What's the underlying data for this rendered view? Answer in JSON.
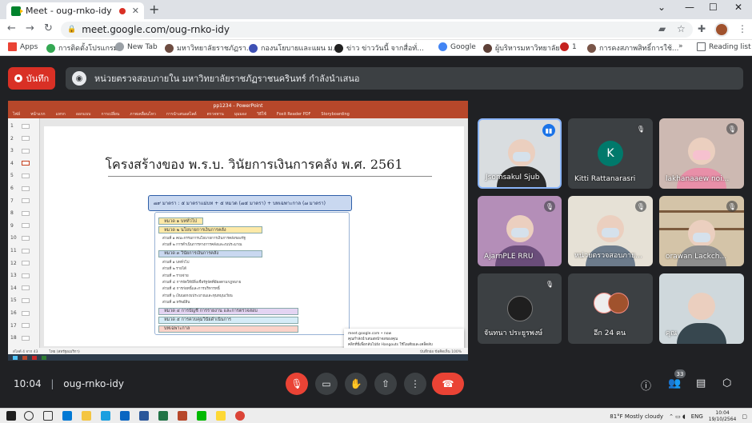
{
  "browser": {
    "tab_title": "Meet - oug-rnko-idy",
    "url": "meet.google.com/oug-rnko-idy",
    "bookmarks": [
      "Apps",
      "การติดตั้งโปรแกรม",
      "New Tab",
      "มหาวิทยาลัยราชภัฏรา...",
      "กองนโยบายและแผน ม...",
      "ข่าว ข่าววันนี้ จากสื่อทั่...",
      "Google",
      "ผู้บริหารมหาวิทยาลัย",
      "1",
      "การคงสภาพสิทธิ์การใช้...",
      "Reading list"
    ]
  },
  "meet": {
    "record_label": "บันทึก",
    "notice": "หน่วยตรวจสอบภายใน มหาวิทยาลัยราชภัฏราชนครินทร์ กำลังนำเสนอ",
    "meeting_code": "oug-rnko-idy",
    "time": "10:04",
    "participant_count": "33"
  },
  "presentation": {
    "window_title": "pp1234 - PowerPoint",
    "ribbon_tabs": [
      "ไฟล์",
      "หน้าแรก",
      "แทรก",
      "ออกแบบ",
      "การเปลี่ยน",
      "ภาพเคลื่อนไหว",
      "การนำเสนอสไลด์",
      "ตรวจทาน",
      "มุมมอง",
      "วิธีใช้",
      "Foxit Reader PDF",
      "Storyboarding"
    ],
    "slide_numbers": [
      "1",
      "2",
      "3",
      "4",
      "5",
      "6",
      "7",
      "8",
      "9",
      "10",
      "11",
      "12",
      "13",
      "14",
      "15",
      "16",
      "17",
      "18"
    ],
    "title": "โครงสร้างของ พ.ร.บ. วินัยการเงินการคลัง พ.ศ. 2561",
    "structure": "๗๙ มาตรา : ๕ มาตราแม่บท + ๕ หมวด (๗๕ มาตรา) + บทเฉพาะกาล (๗ มาตรา)",
    "chapters": [
      {
        "label": "หมวด ๑ บททั่วไป",
        "sections": []
      },
      {
        "label": "หมวด ๒ นโยบายการเงินการคลัง",
        "sections": [
          "ส่วนที่ ๑ คณะกรรมการนโยบายการเงินการคลังของรัฐ",
          "ส่วนที่ ๒ การดำเนินการทางการคลังและงบประมาณ"
        ]
      },
      {
        "label": "หมวด ๓ วินัยการเงินการคลัง",
        "sections": [
          "ส่วนที่ ๑ บททั่วไป",
          "ส่วนที่ ๒ รายได้",
          "ส่วนที่ ๓ รายจ่าย",
          "ส่วนที่ ๔ การจัดให้มีสิ่งเชื่อรัฐจัดที่มีผลตามกฎหมาย",
          "ส่วนที่ ๕ การก่อหนี้และการบริหารหนี้",
          "ส่วนที่ ๖ เงินนอกงบประมาณและทุนหมุนเวียน",
          "ส่วนที่ ๗ ทรัพย์สิน"
        ]
      },
      {
        "label": "หมวด ๔ การบัญชี การรายงาน และการตรวจสอบ",
        "sections": []
      },
      {
        "label": "หมวด ๕ การควบคุมวินัยดำเนินการ",
        "sections": []
      },
      {
        "label": "บทเฉพาะกาล",
        "sections": []
      }
    ],
    "popup": {
      "source": "meet.google.com • now",
      "line1": "คุณกำลังนำเสนอหน้าจอของคุณ",
      "line2": "คลิกที่นี่เพื่อกลับไปยัง Hangouts ใช้ไอเดียและเคล็ดลับ"
    },
    "status_left": "สไลด์ 4 จาก 43",
    "status_mid": "ไทย (สหรัฐอเมริกา)",
    "status_right": "บันทึกย่อ   ข้อคิดเห็น   100%"
  },
  "participants": [
    {
      "name": "Jsomsakul Sjub",
      "speaking": true
    },
    {
      "name": "Kitti Rattanarasri",
      "initial": "K"
    },
    {
      "name": "lakhanaaew noi..."
    },
    {
      "name": "AjarnPLE RRU"
    },
    {
      "name": "หน่วยตรวจสอบภาย..."
    },
    {
      "name": "orawan Lackch..."
    },
    {
      "name": "จันทนา ประยูรพงษ์"
    },
    {
      "name": "อีก 24 คน"
    },
    {
      "name": "คุณ"
    }
  ],
  "taskbar": {
    "weather": "81°F  Mostly cloudy",
    "lang": "ENG",
    "clock_time": "10:04",
    "clock_date": "19/10/2564"
  },
  "colors": {
    "record": "#d93025",
    "hangup": "#ea4335",
    "speaking_border": "#8ab4f8",
    "ppt": "#b7472a"
  }
}
